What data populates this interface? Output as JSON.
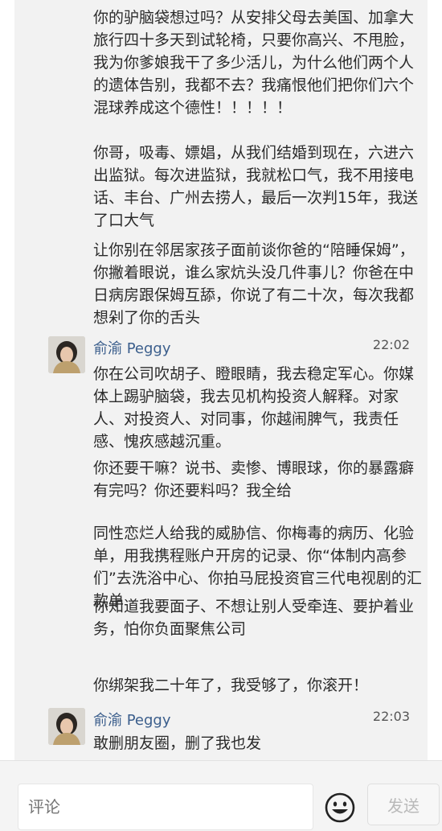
{
  "messages": [
    {
      "paragraphs": [
        "你的驴脑袋想过吗？从安排父母去美国、加拿大旅行四十多天到试轮椅，只要你高兴、不甩脸，我为你爹娘我干了多少活儿，为什么他们两个人的遗体告别，我都不去？我痛恨他们把你们六个混球养成这个德性！！！！！",
        "你哥，吸毒、嫖娼，从我们结婚到现在，六进六出监狱。每次进监狱，我就松口气，我不用接电话、丰台、广州去捞人，最后一次判15年，我送了口大气",
        "让你别在邻居家孩子面前谈你爸的“陪睡保姆”，你撇着眼说，谁么家炕头没几件事儿？你爸在中日病房跟保姆互舔，你说了有二十次，每次我都想剁了你的舌头"
      ]
    },
    {
      "sender": "俞渝 Peggy",
      "time": "22:02",
      "paragraphs": [
        "你在公司吹胡子、瞪眼睛，我去稳定军心。你媒体上踢驴脑袋，我去见机构投资人解释。对家人、对投资人、对同事，你越闹脾气，我责任感、愧疚感越沉重。",
        "你还要干嘛？说书、卖惨、博眼球，你的暴露癖有完吗？你还要料吗？我全给",
        "同性恋烂人给我的威胁信、你梅毒的病历、化验单，用我携程账户开房的记录、你“体制内高参们”去洗浴中心、你拍马屁投资官三代电视剧的汇款单",
        "你知道我要面子、不想让别人受牵连、要护着业务，怕你负面聚焦公司",
        "你绑架我二十年了，我受够了，你滚开！"
      ]
    },
    {
      "sender": "俞渝 Peggy",
      "time": "22:03",
      "paragraphs": [
        "敢删朋友圈，删了我也发"
      ]
    }
  ],
  "comment_bar": {
    "placeholder": "评论",
    "send_label": "发送",
    "emoji_icon": "smiley-face-icon"
  },
  "colors": {
    "chat_bg": "#f2f2f2",
    "sender_name": "#3b5e8c",
    "text": "#2b2b2b",
    "send_disabled": "#b9b9b9"
  }
}
